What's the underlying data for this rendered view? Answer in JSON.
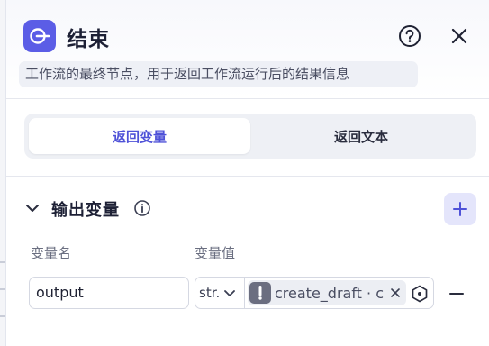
{
  "node": {
    "title": "结束",
    "description": "工作流的最终节点，用于返回工作流运行后的结果信息"
  },
  "tabs": [
    {
      "label": "返回变量",
      "active": true
    },
    {
      "label": "返回文本",
      "active": false
    }
  ],
  "output_section": {
    "title": "输出变量",
    "columns": {
      "name": "变量名",
      "value": "变量值"
    },
    "rows": [
      {
        "name": "output",
        "type": "str.",
        "reference": "create_draft · c"
      }
    ]
  },
  "icons": {
    "node": "end-node-icon",
    "help": "question-circle-icon",
    "close": "close-icon",
    "collapse": "chevron-down-icon",
    "info": "info-circle-icon",
    "add": "plus-icon",
    "warning": "exclamation-icon",
    "remove_ref": "close-icon",
    "node_ref": "hexagon-dot-icon",
    "remove_row": "minus-icon"
  },
  "colors": {
    "accent": "#5b5de6",
    "accent_text": "#4f52d8",
    "add_button_bg": "#e4e5fb",
    "chip_bg": "#eceef3"
  }
}
